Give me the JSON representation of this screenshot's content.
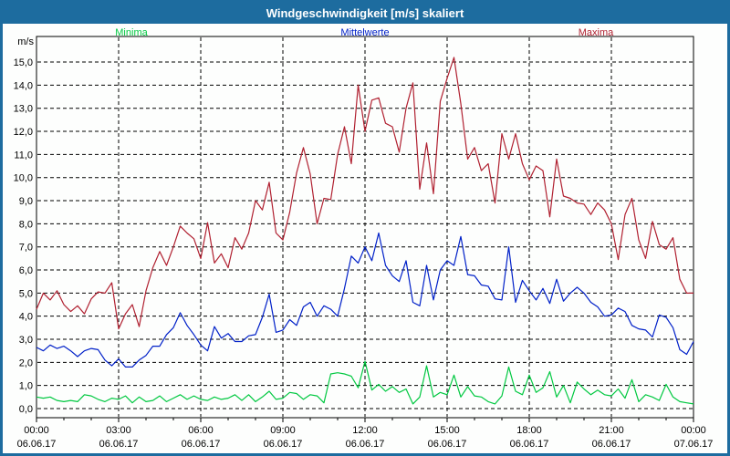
{
  "title_bar": {
    "title": "Windgeschwindigkeit [m/s] skaliert",
    "bg_color": "#1d6c9f",
    "text_color": "#ffffff"
  },
  "unit_label": "m/s",
  "legend": {
    "items": [
      {
        "label": "Minima",
        "color": "#00c840"
      },
      {
        "label": "Mittelwerte",
        "color": "#0020c8"
      },
      {
        "label": "Maxima",
        "color": "#b02030"
      }
    ]
  },
  "chart_data": {
    "type": "line",
    "title": "Windgeschwindigkeit [m/s] skaliert",
    "ylabel": "m/s",
    "ylim": [
      0,
      15
    ],
    "grid": "dashed",
    "legend_position": "top",
    "y_tick_labels": [
      "15,0",
      "14,0",
      "13,0",
      "12,0",
      "11,0",
      "10,0",
      "9,0",
      "8,0",
      "7,0",
      "6,0",
      "5,0",
      "4,0",
      "3,0",
      "2,0",
      "1,0",
      "0,0"
    ],
    "x_ticks": [
      {
        "time": "00:00",
        "date": "06.06.17"
      },
      {
        "time": "03:00",
        "date": "06.06.17"
      },
      {
        "time": "06:00",
        "date": "06.06.17"
      },
      {
        "time": "09:00",
        "date": "06.06.17"
      },
      {
        "time": "12:00",
        "date": "06.06.17"
      },
      {
        "time": "15:00",
        "date": "06.06.17"
      },
      {
        "time": "18:00",
        "date": "06.06.17"
      },
      {
        "time": "21:00",
        "date": "06.06.17"
      },
      {
        "time": "00:00",
        "date": "07.06.17"
      }
    ],
    "x_hours_range": [
      0,
      24
    ],
    "sample_interval_hours": 0.25,
    "series": [
      {
        "name": "Minima",
        "color": "#00c840",
        "values": [
          0.5,
          0.45,
          0.5,
          0.35,
          0.3,
          0.35,
          0.3,
          0.6,
          0.55,
          0.4,
          0.3,
          0.45,
          0.4,
          0.55,
          0.25,
          0.5,
          0.3,
          0.35,
          0.55,
          0.3,
          0.45,
          0.6,
          0.4,
          0.55,
          0.4,
          0.35,
          0.5,
          0.4,
          0.45,
          0.6,
          0.35,
          0.6,
          0.3,
          0.5,
          0.75,
          0.4,
          0.45,
          0.7,
          0.65,
          0.4,
          0.6,
          0.55,
          0.25,
          1.5,
          1.55,
          1.5,
          1.4,
          0.9,
          2.05,
          0.8,
          1.05,
          0.75,
          0.95,
          0.7,
          0.85,
          0.2,
          0.5,
          1.85,
          0.5,
          0.7,
          0.6,
          1.45,
          0.5,
          0.95,
          0.55,
          0.5,
          0.3,
          0.2,
          0.55,
          1.8,
          0.75,
          0.6,
          1.45,
          0.7,
          0.9,
          1.6,
          0.5,
          1.0,
          0.25,
          1.15,
          0.85,
          0.6,
          0.8,
          0.6,
          0.55,
          0.85,
          0.45,
          1.25,
          0.3,
          0.6,
          0.5,
          0.35,
          1.05,
          0.5,
          0.3,
          0.25,
          0.2
        ]
      },
      {
        "name": "Mittelwerte",
        "color": "#0020c8",
        "values": [
          2.65,
          2.5,
          2.75,
          2.6,
          2.7,
          2.5,
          2.25,
          2.5,
          2.6,
          2.55,
          2.1,
          1.85,
          2.15,
          1.8,
          1.8,
          2.1,
          2.3,
          2.7,
          2.7,
          3.2,
          3.5,
          4.15,
          3.6,
          3.2,
          2.75,
          2.5,
          3.55,
          3.05,
          3.25,
          2.9,
          2.9,
          3.15,
          3.2,
          3.95,
          4.95,
          3.3,
          3.4,
          3.85,
          3.6,
          4.4,
          4.6,
          4.0,
          4.45,
          4.3,
          4.0,
          5.2,
          6.6,
          6.3,
          7.0,
          6.4,
          7.6,
          6.2,
          5.75,
          5.5,
          6.4,
          4.6,
          4.45,
          6.2,
          4.7,
          6.0,
          6.4,
          6.2,
          7.45,
          5.8,
          5.75,
          5.35,
          5.3,
          4.75,
          4.7,
          7.0,
          4.6,
          5.55,
          5.1,
          4.7,
          5.2,
          4.55,
          5.6,
          4.65,
          5.0,
          5.25,
          5.0,
          4.6,
          4.4,
          4.0,
          4.05,
          4.35,
          4.2,
          3.6,
          3.45,
          3.4,
          3.1,
          4.05,
          3.95,
          3.5,
          2.55,
          2.35,
          2.9
        ]
      },
      {
        "name": "Maxima",
        "color": "#b02030",
        "values": [
          4.3,
          5.0,
          4.7,
          5.1,
          4.5,
          4.2,
          4.45,
          4.1,
          4.75,
          5.05,
          5.0,
          5.45,
          3.45,
          4.1,
          4.5,
          3.55,
          5.1,
          6.1,
          6.8,
          6.2,
          7.0,
          7.9,
          7.6,
          7.35,
          6.5,
          8.05,
          6.3,
          6.7,
          6.1,
          7.4,
          6.9,
          7.6,
          9.0,
          8.6,
          9.8,
          7.6,
          7.3,
          8.5,
          10.2,
          11.3,
          10.15,
          8.0,
          9.1,
          9.05,
          11.0,
          12.2,
          10.6,
          14.0,
          12.0,
          13.35,
          13.45,
          12.35,
          12.2,
          11.1,
          13.0,
          14.1,
          9.5,
          11.5,
          9.3,
          13.3,
          14.3,
          15.2,
          13.2,
          10.8,
          11.3,
          10.3,
          10.6,
          8.9,
          11.9,
          10.8,
          11.9,
          10.6,
          9.9,
          10.5,
          10.3,
          8.3,
          10.8,
          9.2,
          9.1,
          8.9,
          8.85,
          8.4,
          8.9,
          8.6,
          8.0,
          6.45,
          8.4,
          9.1,
          7.3,
          6.5,
          8.1,
          7.1,
          6.9,
          7.4,
          5.6,
          5.0,
          5.0
        ]
      }
    ]
  }
}
